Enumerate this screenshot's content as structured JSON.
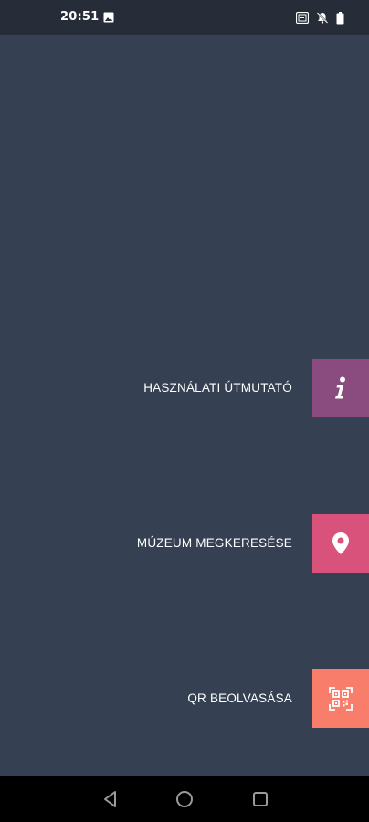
{
  "status_bar": {
    "time": "20:51",
    "icons": [
      "image-icon",
      "vibrate-icon",
      "silent-bell-icon",
      "battery-icon"
    ]
  },
  "menu": {
    "items": [
      {
        "label": "HASZNÁLATI ÚTMUTATÓ",
        "icon": "info-icon",
        "color": "#8a4c7f"
      },
      {
        "label": "MÚZEUM MEGKERESÉSE",
        "icon": "location-pin-icon",
        "color": "#d9527c"
      },
      {
        "label": "QR BEOLVASÁSA",
        "icon": "qr-code-icon",
        "color": "#f97d6b"
      }
    ]
  },
  "nav_bar": {
    "buttons": [
      "back-icon",
      "home-icon",
      "recents-icon"
    ]
  },
  "colors": {
    "background": "#354052",
    "status_bar": "#262c38",
    "nav_bar": "#000000"
  }
}
